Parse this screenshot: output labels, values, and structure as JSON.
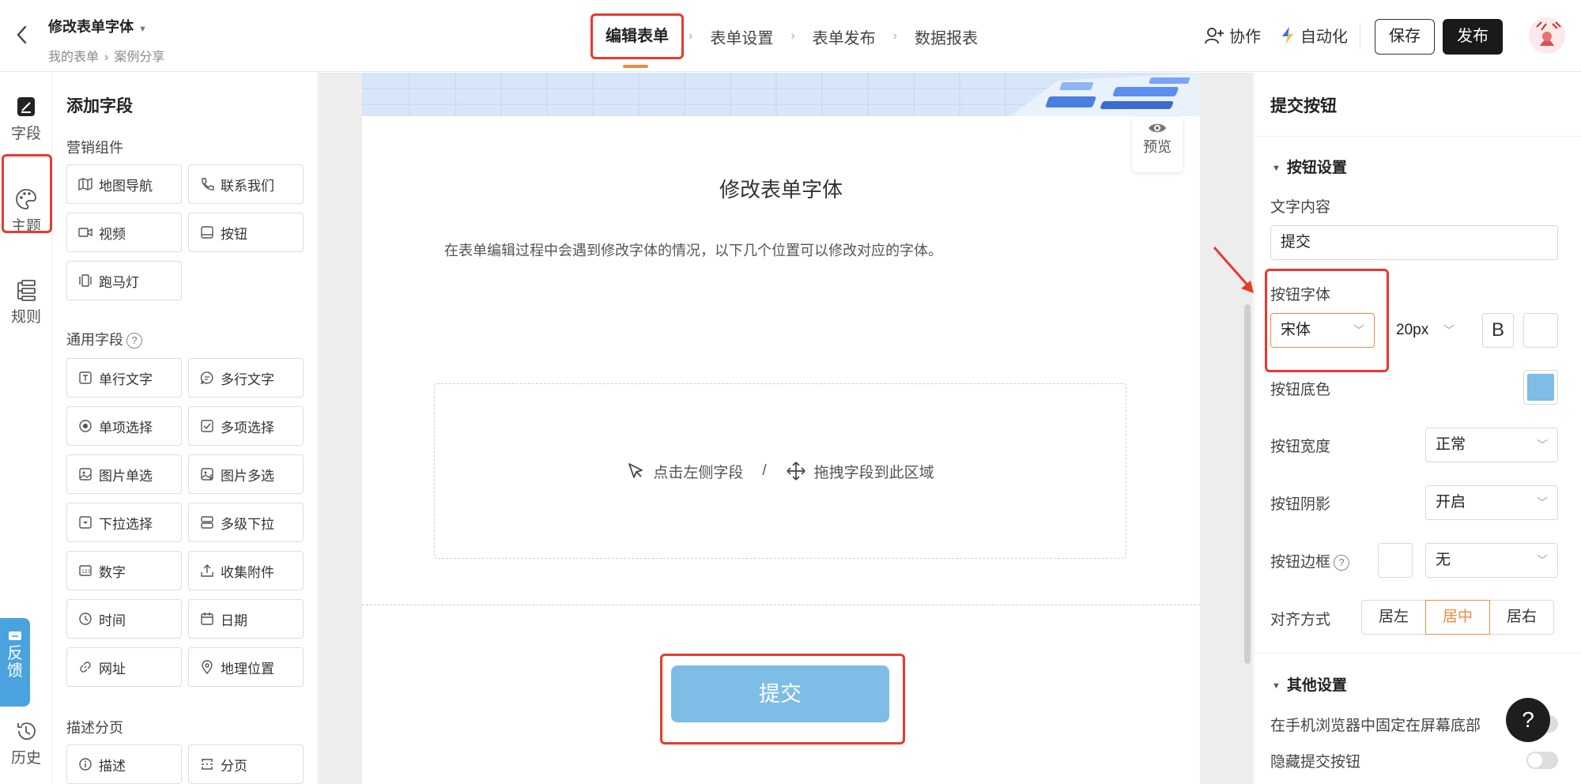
{
  "header": {
    "back_icon": "chevron-left-icon",
    "title": "修改表单字体",
    "breadcrumb": [
      "我的表单",
      "案例分享"
    ],
    "steps": [
      "编辑表单",
      "表单设置",
      "表单发布",
      "数据报表"
    ],
    "active_step": "编辑表单",
    "collab_label": "协作",
    "automation_label": "自动化",
    "save_label": "保存",
    "publish_label": "发布"
  },
  "rail": {
    "items": [
      {
        "label": "字段",
        "icon": "edit-doc-icon"
      },
      {
        "label": "主题",
        "icon": "palette-icon"
      },
      {
        "label": "规则",
        "icon": "rule-tree-icon"
      },
      {
        "label": "历史",
        "icon": "history-icon"
      }
    ],
    "feedback_label": "反馈"
  },
  "field_panel": {
    "title": "添加字段",
    "groups": [
      {
        "title": "营销组件",
        "items": [
          "地图导航",
          "联系我们",
          "视频",
          "按钮",
          "跑马灯"
        ]
      },
      {
        "title": "通用字段",
        "items": [
          "单行文字",
          "多行文字",
          "单项选择",
          "多项选择",
          "图片单选",
          "图片多选",
          "下拉选择",
          "多级下拉",
          "数字",
          "收集附件",
          "时间",
          "日期",
          "网址",
          "地理位置"
        ]
      },
      {
        "title": "描述分页",
        "items": [
          "描述",
          "分页"
        ]
      }
    ]
  },
  "canvas": {
    "preview_label": "预览",
    "form_title": "修改表单字体",
    "form_desc": "在表单编辑过程中会遇到修改字体的情况，以下几个位置可以修改对应的字体。",
    "drop_hint_left": "点击左侧字段",
    "drop_hint_sep": "/",
    "drop_hint_right": "拖拽字段到此区域",
    "submit_label": "提交"
  },
  "right_panel": {
    "title": "提交按钮",
    "section_button": "按钮设置",
    "text_content_label": "文字内容",
    "text_content_value": "提交",
    "font_label": "按钮字体",
    "font_value": "宋体",
    "font_size_value": "20px",
    "bold_label": "B",
    "bg_color_label": "按钮底色",
    "bg_color": "#7dbde6",
    "width_label": "按钮宽度",
    "width_value": "正常",
    "shadow_label": "按钮阴影",
    "shadow_value": "开启",
    "border_label": "按钮边框",
    "border_value": "无",
    "align_label": "对齐方式",
    "align_options": [
      "居左",
      "居中",
      "居右"
    ],
    "align_active": "居中",
    "section_other": "其他设置",
    "fixed_bottom_label": "在手机浏览器中固定在屏幕底部",
    "hide_submit_label": "隐藏提交按钮"
  },
  "help_label": "?",
  "colors": {
    "accent": "#f08a3e",
    "highlight": "#e83a2d",
    "submit": "#7dbde6"
  }
}
